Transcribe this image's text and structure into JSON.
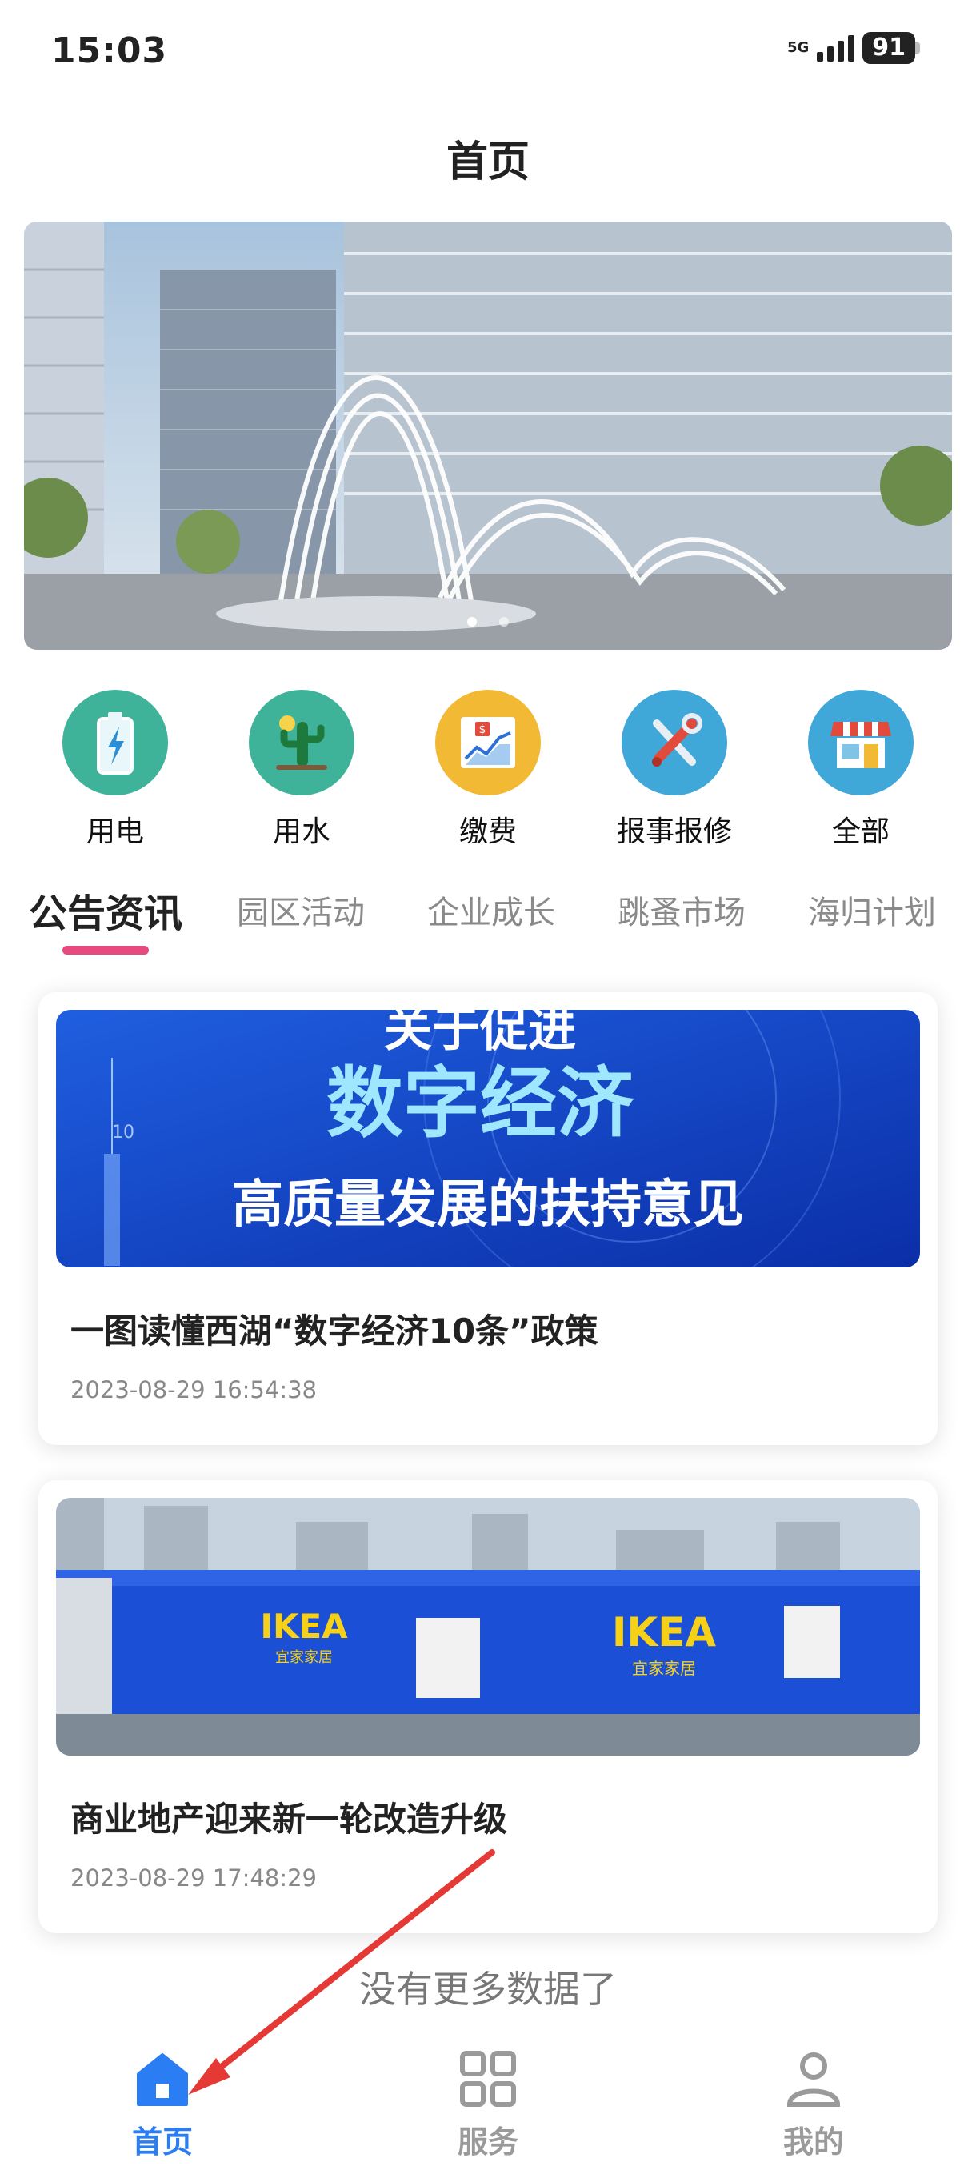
{
  "status_bar": {
    "time": "15:03",
    "network": "5G",
    "battery": "91"
  },
  "header": {
    "title": "首页"
  },
  "quick_actions": [
    {
      "label": "用电",
      "icon": "battery-charging-icon",
      "color": "#3fb39a"
    },
    {
      "label": "用水",
      "icon": "cactus-icon",
      "color": "#3fb39a"
    },
    {
      "label": "缴费",
      "icon": "payment-chart-icon",
      "color": "#f2b935"
    },
    {
      "label": "报事报修",
      "icon": "repair-tools-icon",
      "color": "#3fa8d9"
    },
    {
      "label": "全部",
      "icon": "store-icon",
      "color": "#3fa8d9"
    }
  ],
  "tabs": [
    {
      "label": "公告资讯",
      "active": true
    },
    {
      "label": "园区活动",
      "active": false
    },
    {
      "label": "企业成长",
      "active": false
    },
    {
      "label": "跳蚤市场",
      "active": false
    },
    {
      "label": "海归计划",
      "active": false
    }
  ],
  "news": [
    {
      "image_text": {
        "line1": "关于促进",
        "line2": "数字经济",
        "line3": "高质量发展的扶持意见"
      },
      "title": "一图读懂西湖“数字经济10条”政策",
      "time": "2023-08-29 16:54:38"
    },
    {
      "image_text": {
        "sign1": "IKEA",
        "sign1_sub": "宜家家居",
        "sign2": "IKEA",
        "sign2_sub": "宜家家居"
      },
      "title": "商业地产迎来新一轮改造升级",
      "time": "2023-08-29 17:48:29"
    }
  ],
  "list_end_text": "没有更多数据了",
  "bottom_nav": [
    {
      "label": "首页",
      "icon": "home-icon",
      "active": true
    },
    {
      "label": "服务",
      "icon": "grid-icon",
      "active": false
    },
    {
      "label": "我的",
      "icon": "user-icon",
      "active": false
    }
  ],
  "colors": {
    "accent": "#2a7df2",
    "tab_underline": "#e84a7f",
    "annotation_arrow": "#e53935"
  }
}
